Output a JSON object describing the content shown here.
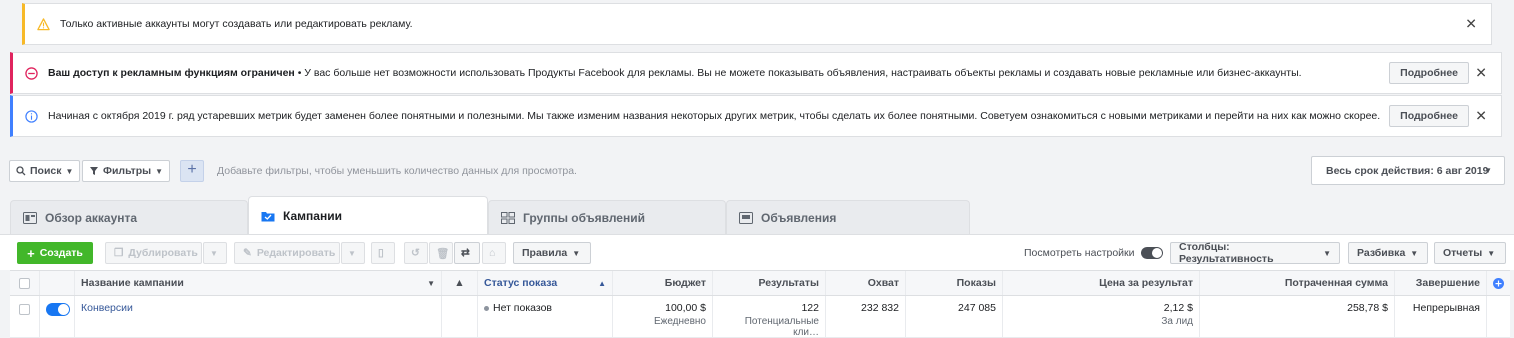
{
  "banners": {
    "warning": {
      "text": "Только активные аккаунты могут создавать или редактировать рекламу."
    },
    "error": {
      "bold": "Ваш доступ к рекламным функциям ограничен",
      "text": " • У вас больше нет возможности использовать Продукты Facebook для рекламы. Вы не можете показывать объявления, настраивать объекты рекламы и создавать новые рекламные или бизнес-аккаунты.",
      "button": "Подробнее"
    },
    "info": {
      "text": "Начиная с октября 2019 г. ряд устаревших метрик будет заменен более понятными и полезными. Мы также изменим названия некоторых других метрик, чтобы сделать их более понятными. Советуем ознакомиться с новыми метриками и перейти на них как можно скорее.",
      "button": "Подробнее"
    },
    "close": "✕"
  },
  "filterbar": {
    "search": "Поиск",
    "filters": "Фильтры",
    "plus": "+",
    "hint": "Добавьте фильтры, чтобы уменьшить количество данных для просмотра.",
    "daterange": "Весь срок действия: 6 авг 2019"
  },
  "tabs": [
    {
      "label": "Обзор аккаунта",
      "active": false
    },
    {
      "label": "Кампании",
      "active": true
    },
    {
      "label": "Группы объявлений",
      "active": false
    },
    {
      "label": "Объявления",
      "active": false
    }
  ],
  "toolbar": {
    "create": "Создать",
    "duplicate": "Дублировать",
    "edit": "Редактировать",
    "rules": "Правила",
    "view_settings": "Посмотреть настройки",
    "columns": "Столбцы: Результативность",
    "breakdown": "Разбивка",
    "reports": "Отчеты"
  },
  "table": {
    "headers": {
      "name": "Название кампании",
      "status": "Статус показа",
      "budget": "Бюджет",
      "results": "Результаты",
      "reach": "Охват",
      "impressions": "Показы",
      "cost_per_result": "Цена за результат",
      "amount_spent": "Потраченная сумма",
      "end": "Завершение"
    },
    "rows": [
      {
        "name": "Конверсии",
        "status": "Нет показов",
        "budget": "100,00 $",
        "budget_type": "Ежедневно",
        "results": "122",
        "results_type": "Потенциальные кли…",
        "reach": "232 832",
        "impressions": "247 085",
        "cost_per_result": "2,12 $",
        "cost_type": "За лид",
        "amount_spent": "258,78 $",
        "end": "Непрерывная"
      }
    ]
  },
  "colors": {
    "accent": "#1877f2",
    "create": "#42b72a",
    "warning": "#f7b928",
    "error": "#e0245e",
    "info": "#4080ff"
  }
}
